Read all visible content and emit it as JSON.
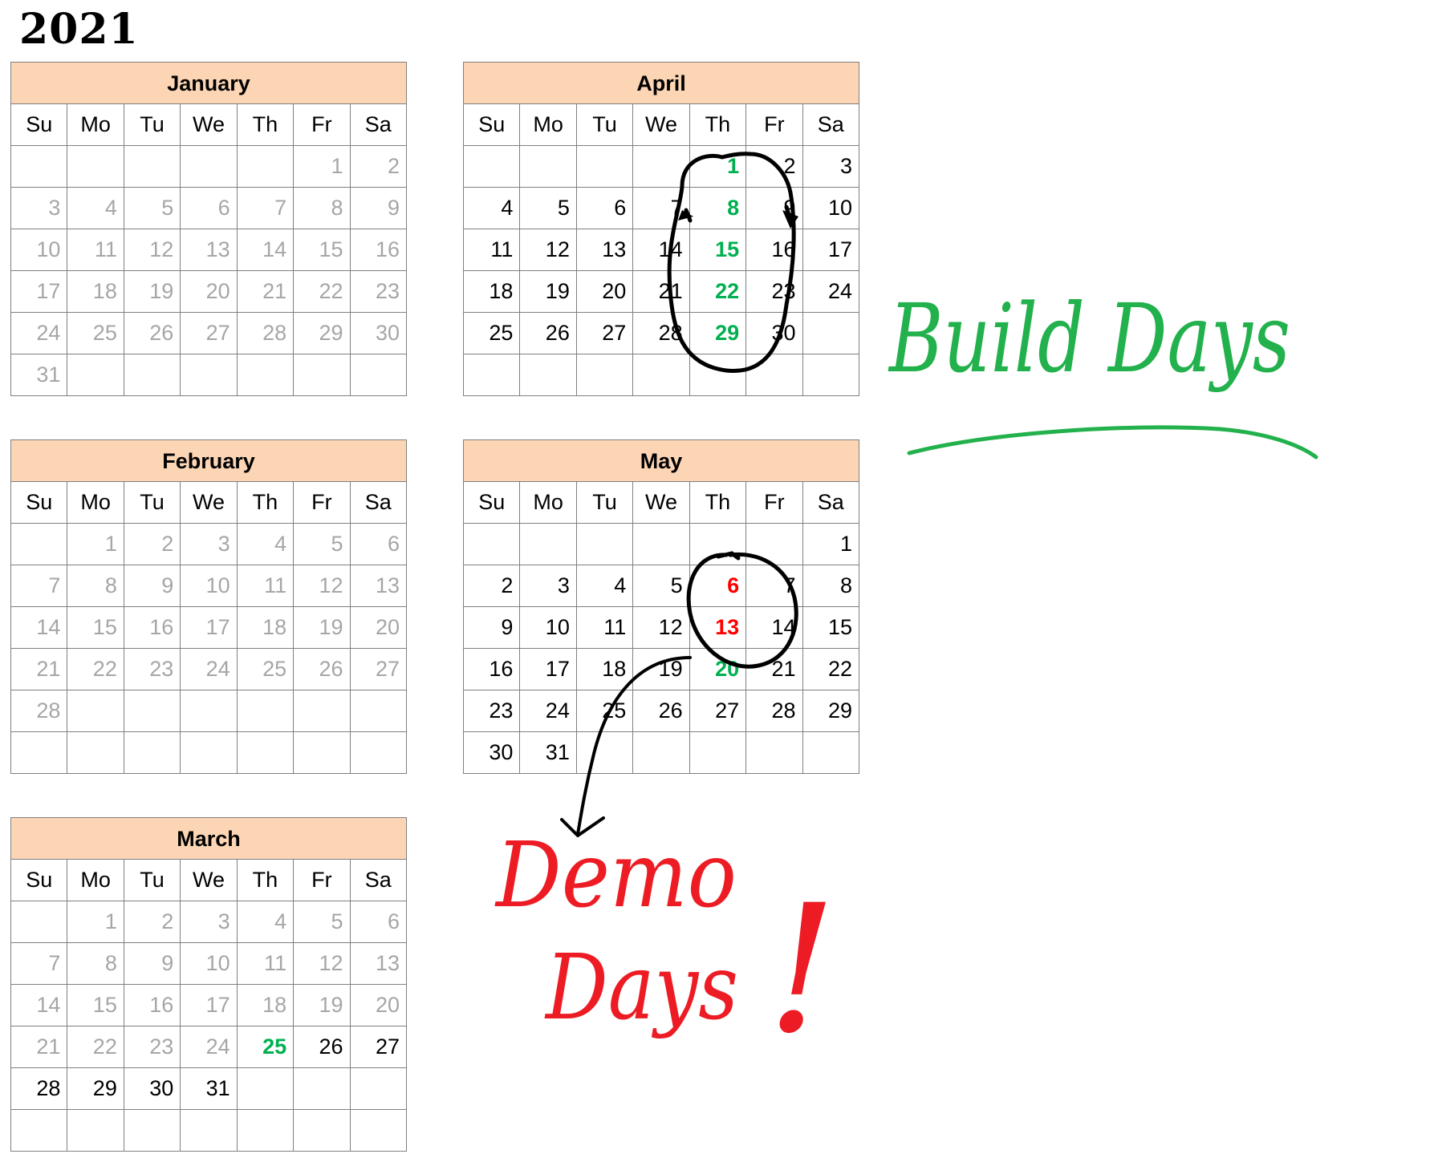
{
  "year": "2021",
  "weekdays": [
    "Su",
    "Mo",
    "Tu",
    "We",
    "Th",
    "Fr",
    "Sa"
  ],
  "months": [
    {
      "key": "january",
      "name": "January",
      "start": 5,
      "days": 31,
      "rows": 6,
      "muted_through": 31,
      "build": [],
      "demo": []
    },
    {
      "key": "february",
      "name": "February",
      "start": 1,
      "days": 28,
      "rows": 6,
      "muted_through": 28,
      "build": [],
      "demo": []
    },
    {
      "key": "march",
      "name": "March",
      "start": 1,
      "days": 31,
      "rows": 6,
      "muted_through": 24,
      "build": [
        25
      ],
      "demo": []
    },
    {
      "key": "april",
      "name": "April",
      "start": 4,
      "days": 30,
      "rows": 6,
      "muted_through": 0,
      "build": [
        1,
        8,
        15,
        22,
        29
      ],
      "demo": []
    },
    {
      "key": "may",
      "name": "May",
      "start": 6,
      "days": 31,
      "rows": 6,
      "muted_through": 0,
      "build": [
        20
      ],
      "demo": [
        6,
        13
      ]
    }
  ],
  "annotations": {
    "build_days": "Build Days",
    "demo_days_line1": "Demo",
    "demo_days_line2": "Days",
    "exclaim": "!"
  },
  "colors": {
    "header_fill": "#fcd5b5",
    "muted_text": "#a6a6a6",
    "build_green": "#00b050",
    "demo_red": "#ff0000",
    "ink_green": "#22b14c",
    "ink_red": "#ed1c24",
    "ink_black": "#000000"
  }
}
